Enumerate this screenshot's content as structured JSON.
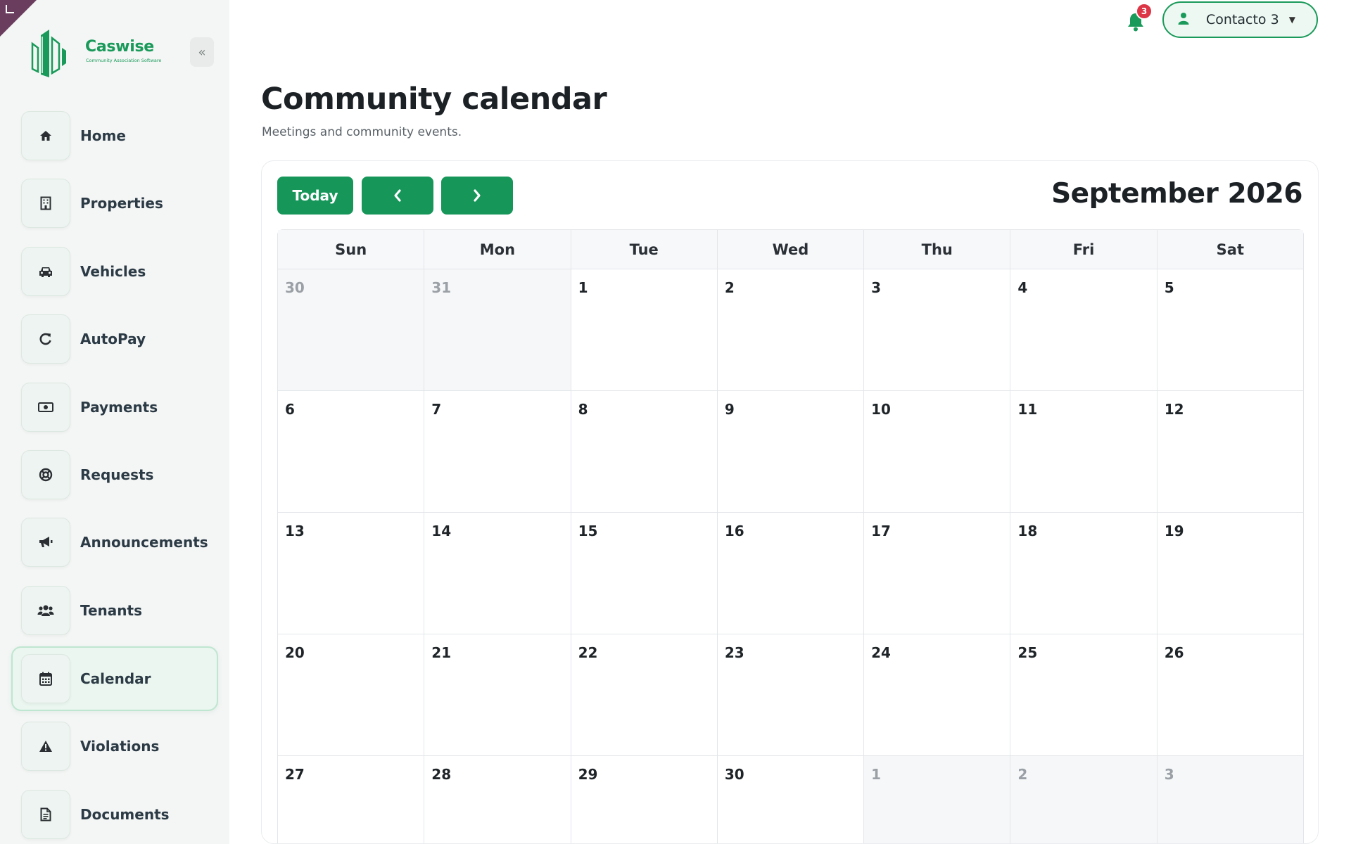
{
  "brand": {
    "name": "Caswise",
    "tagline": "Community Association Software",
    "color": "#1a9a5a"
  },
  "sidebar": {
    "collapse_label": "«",
    "items": [
      {
        "label": "Home",
        "icon": "home-icon"
      },
      {
        "label": "Properties",
        "icon": "building-icon"
      },
      {
        "label": "Vehicles",
        "icon": "car-icon"
      },
      {
        "label": "AutoPay",
        "icon": "refresh-icon"
      },
      {
        "label": "Payments",
        "icon": "money-icon"
      },
      {
        "label": "Requests",
        "icon": "lifebuoy-icon"
      },
      {
        "label": "Announcements",
        "icon": "megaphone-icon"
      },
      {
        "label": "Tenants",
        "icon": "users-icon"
      },
      {
        "label": "Calendar",
        "icon": "calendar-icon",
        "active": true
      },
      {
        "label": "Violations",
        "icon": "warning-icon"
      },
      {
        "label": "Documents",
        "icon": "document-icon"
      }
    ]
  },
  "header": {
    "notifications_count": "3",
    "user_name": "Contacto 3"
  },
  "page": {
    "title": "Community calendar",
    "subtitle": "Meetings and community events."
  },
  "calendar": {
    "today_label": "Today",
    "month_title": "September 2026",
    "weekdays": [
      "Sun",
      "Mon",
      "Tue",
      "Wed",
      "Thu",
      "Fri",
      "Sat"
    ],
    "weeks": [
      [
        {
          "d": "30",
          "o": true
        },
        {
          "d": "31",
          "o": true
        },
        {
          "d": "1"
        },
        {
          "d": "2"
        },
        {
          "d": "3"
        },
        {
          "d": "4"
        },
        {
          "d": "5"
        }
      ],
      [
        {
          "d": "6"
        },
        {
          "d": "7"
        },
        {
          "d": "8"
        },
        {
          "d": "9"
        },
        {
          "d": "10"
        },
        {
          "d": "11"
        },
        {
          "d": "12"
        }
      ],
      [
        {
          "d": "13"
        },
        {
          "d": "14"
        },
        {
          "d": "15"
        },
        {
          "d": "16"
        },
        {
          "d": "17"
        },
        {
          "d": "18"
        },
        {
          "d": "19"
        }
      ],
      [
        {
          "d": "20"
        },
        {
          "d": "21"
        },
        {
          "d": "22"
        },
        {
          "d": "23"
        },
        {
          "d": "24"
        },
        {
          "d": "25"
        },
        {
          "d": "26"
        }
      ],
      [
        {
          "d": "27"
        },
        {
          "d": "28"
        },
        {
          "d": "29"
        },
        {
          "d": "30"
        },
        {
          "d": "1",
          "o": true
        },
        {
          "d": "2",
          "o": true
        },
        {
          "d": "3",
          "o": true
        }
      ]
    ]
  }
}
